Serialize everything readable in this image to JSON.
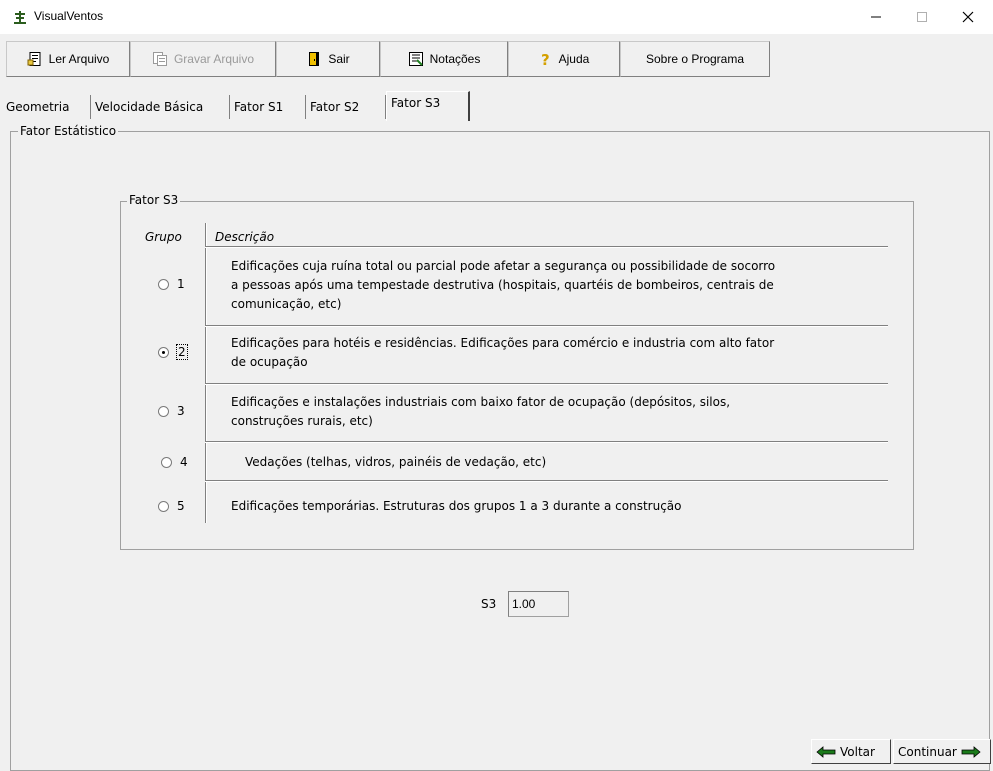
{
  "window": {
    "title": "VisualVentos",
    "controls": {
      "minimize": "—",
      "maximize": "☐",
      "close": "✕"
    }
  },
  "toolbar": {
    "buttons": [
      {
        "label": "Ler Arquivo",
        "icon": "open-file-icon",
        "enabled": true
      },
      {
        "label": "Gravar Arquivo",
        "icon": "save-file-icon",
        "enabled": false
      },
      {
        "label": "Sair",
        "icon": "exit-door-icon",
        "enabled": true
      },
      {
        "label": "Notações",
        "icon": "notes-icon",
        "enabled": true
      },
      {
        "label": "Ajuda",
        "icon": "help-question-icon",
        "enabled": true
      },
      {
        "label": "Sobre o Programa",
        "icon": "",
        "enabled": true
      }
    ]
  },
  "tabs": [
    {
      "label": "Geometria",
      "active": false
    },
    {
      "label": "Velocidade Básica",
      "active": false
    },
    {
      "label": "Fator S1",
      "active": false
    },
    {
      "label": "Fator S2",
      "active": false
    },
    {
      "label": "Fator S3",
      "active": true
    }
  ],
  "panel": {
    "title": "Fator Estátistico",
    "group": {
      "title": "Fator S3",
      "col_group": "Grupo",
      "col_desc": "Descrição",
      "rows": [
        {
          "group": "1",
          "selected": false,
          "desc_lines": [
            "Edificações cuja ruína total ou parcial pode afetar a segurança ou possibilidade de socorro",
            "a pessoas após uma tempestade destrutiva (hospitais, quartéis de bombeiros, centrais de",
            "comunicação, etc)"
          ]
        },
        {
          "group": "2",
          "selected": true,
          "desc_lines": [
            "Edificações para hotéis e residências. Edificações para comércio e industria com alto fator",
            "de ocupação"
          ]
        },
        {
          "group": "3",
          "selected": false,
          "desc_lines": [
            "Edificações e instalações industriais com baixo fator de ocupação (depósitos, silos,",
            "construções rurais, etc)"
          ]
        },
        {
          "group": "4",
          "selected": false,
          "desc_lines": [
            "Vedações (telhas, vidros, painéis de vedação, etc)"
          ]
        },
        {
          "group": "5",
          "selected": false,
          "desc_lines": [
            "Edificações temporárias. Estruturas dos grupos 1 a 3 durante a construção"
          ]
        }
      ]
    },
    "s3": {
      "label": "S3",
      "value": "1.00"
    }
  },
  "nav": {
    "back_label": "Voltar",
    "next_label": "Continuar"
  },
  "colors": {
    "face": "#f0f0f0",
    "arrow": "#1a7a1a",
    "help": "#d4a000"
  }
}
